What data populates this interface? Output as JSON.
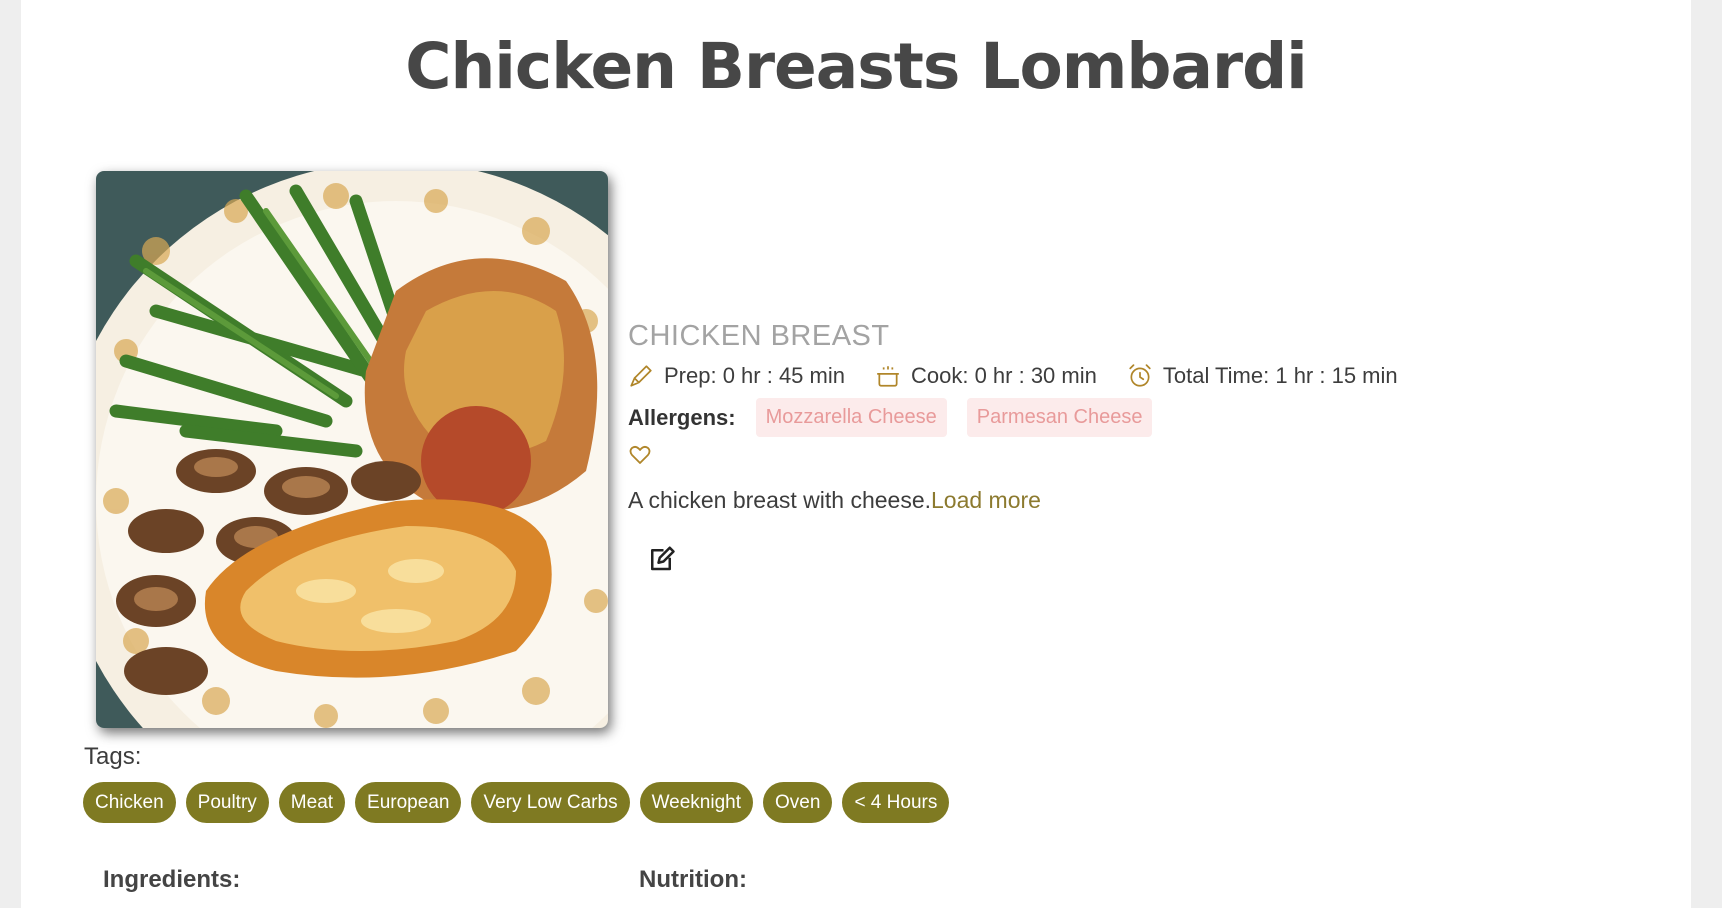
{
  "recipe": {
    "title": "Chicken Breasts Lombardi",
    "category": "CHICKEN BREAST",
    "prep_time": "Prep: 0 hr : 45 min",
    "cook_time": "Cook: 0 hr : 30 min",
    "total_time": "Total Time: 1 hr : 15 min",
    "allergens_label": "Allergens:",
    "allergens": [
      "Mozzarella Cheese",
      "Parmesan Cheese"
    ],
    "description": "A chicken breast with cheese.",
    "load_more": "Load more"
  },
  "tags": {
    "label": "Tags:",
    "items": [
      "Chicken",
      "Poultry",
      "Meat",
      "European",
      "Very Low Carbs",
      "Weeknight",
      "Oven",
      "< 4 Hours"
    ]
  },
  "sections": {
    "ingredients": "Ingredients:",
    "nutrition": "Nutrition:"
  },
  "colors": {
    "accent": "#8c7a2f",
    "tag_bg": "#7f7a22",
    "allergen_bg": "#fcebeb",
    "allergen_text": "#e89a9a"
  },
  "icons": {
    "prep": "pencil-icon",
    "cook": "pot-icon",
    "total": "alarm-clock-icon",
    "favorite": "heart-icon",
    "edit": "edit-icon"
  }
}
